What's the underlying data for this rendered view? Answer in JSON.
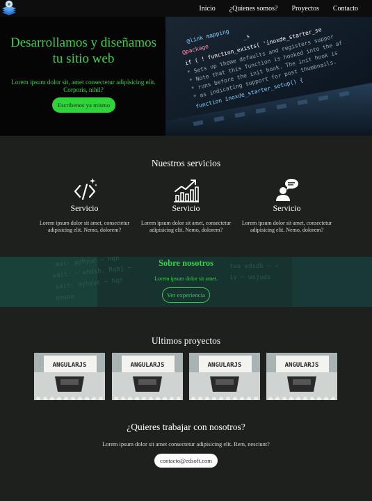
{
  "nav": {
    "logo_icon": "layers-logo-icon",
    "links": [
      "Inicio",
      "¿Quienes somos?",
      "Proyectos",
      "Contacto"
    ]
  },
  "hero": {
    "title": "Desarrollamos y diseñamos tu sitio web",
    "subtitle": "Lorem ipsum dolor sit, amet consectetur adipisicing elit. Corporis, nihil?",
    "button": "Escribenos ya mismo",
    "accent": "#3bd14a"
  },
  "services": {
    "title": "Nuestros servicios",
    "items": [
      {
        "icon": "code-icon",
        "title": "Servicio",
        "desc": "Lorem ipsum dolor sit amet, consectetur adipisicing elit. Nemo, dolorem?"
      },
      {
        "icon": "growth-chart-icon",
        "title": "Servicio",
        "desc": "Lorem ipsum dolor sit amet, consectetur adipisicing elit. Nemo, dolorem?"
      },
      {
        "icon": "person-chat-icon",
        "title": "Servicio",
        "desc": "Lorem ipsum dolor sit amet, consectetur adipisicing elit. Nemo, dolorem?"
      }
    ]
  },
  "about": {
    "title": "Sobre nosotros",
    "subtitle": "Lorem ipsum dolor sit amet.",
    "button": "Ver experiencia"
  },
  "projects": {
    "title": "Ultimos proyectos",
    "items": [
      {
        "label": "ANGULARJS"
      },
      {
        "label": "ANGULARJS"
      },
      {
        "label": "ANGULARJS"
      },
      {
        "label": "ANGULARJS"
      }
    ]
  },
  "contact": {
    "title": "¿Quieres trabajar con nosotros?",
    "subtitle": "Lorem ipsum dolor sit amet consectetur adipisicing elit. Rem, nesciunt?",
    "button": "contacto@edsoft.com"
  }
}
